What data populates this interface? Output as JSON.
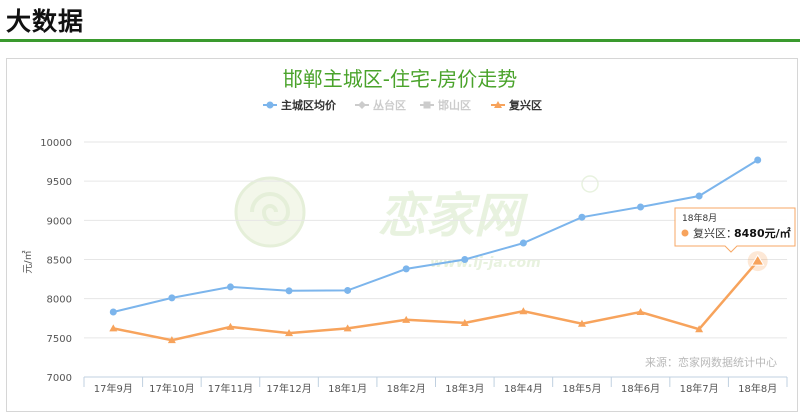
{
  "page": {
    "section_title": "大数据"
  },
  "chart_data": {
    "type": "line",
    "title": "邯郸主城区-住宅-房价走势",
    "ylabel": "元/㎡",
    "xlabel": "",
    "categories": [
      "17年9月",
      "17年10月",
      "17年11月",
      "17年12月",
      "18年1月",
      "18年2月",
      "18年3月",
      "18年4月",
      "18年5月",
      "18年6月",
      "18年7月",
      "18年8月"
    ],
    "ylim": [
      7000,
      10000
    ],
    "yticks": [
      7000,
      7500,
      8000,
      8500,
      9000,
      9500,
      10000
    ],
    "grid": true,
    "legend_position": "top-center",
    "series": [
      {
        "name": "主城区均价",
        "color": "#7cb5ec",
        "marker": "circle",
        "visible": true,
        "values": [
          7830,
          8010,
          8150,
          8100,
          8105,
          8380,
          8500,
          8710,
          9040,
          9170,
          9310,
          9770
        ]
      },
      {
        "name": "丛台区",
        "color": "#cccccc",
        "marker": "diamond",
        "visible": false,
        "values": []
      },
      {
        "name": "邯山区",
        "color": "#cccccc",
        "marker": "square",
        "visible": false,
        "values": []
      },
      {
        "name": "复兴区",
        "color": "#f7a35c",
        "marker": "triangle",
        "visible": true,
        "values": [
          7620,
          7470,
          7640,
          7560,
          7620,
          7730,
          7690,
          7840,
          7680,
          7830,
          7610,
          8480
        ]
      }
    ],
    "tooltip": {
      "date": "18年8月",
      "series": "复兴区",
      "value_text": "8480元/㎡"
    },
    "source_note": "来源：恋家网数据统计中心",
    "watermark": {
      "text": "恋家网",
      "url": "www.lj-ja.com"
    }
  }
}
